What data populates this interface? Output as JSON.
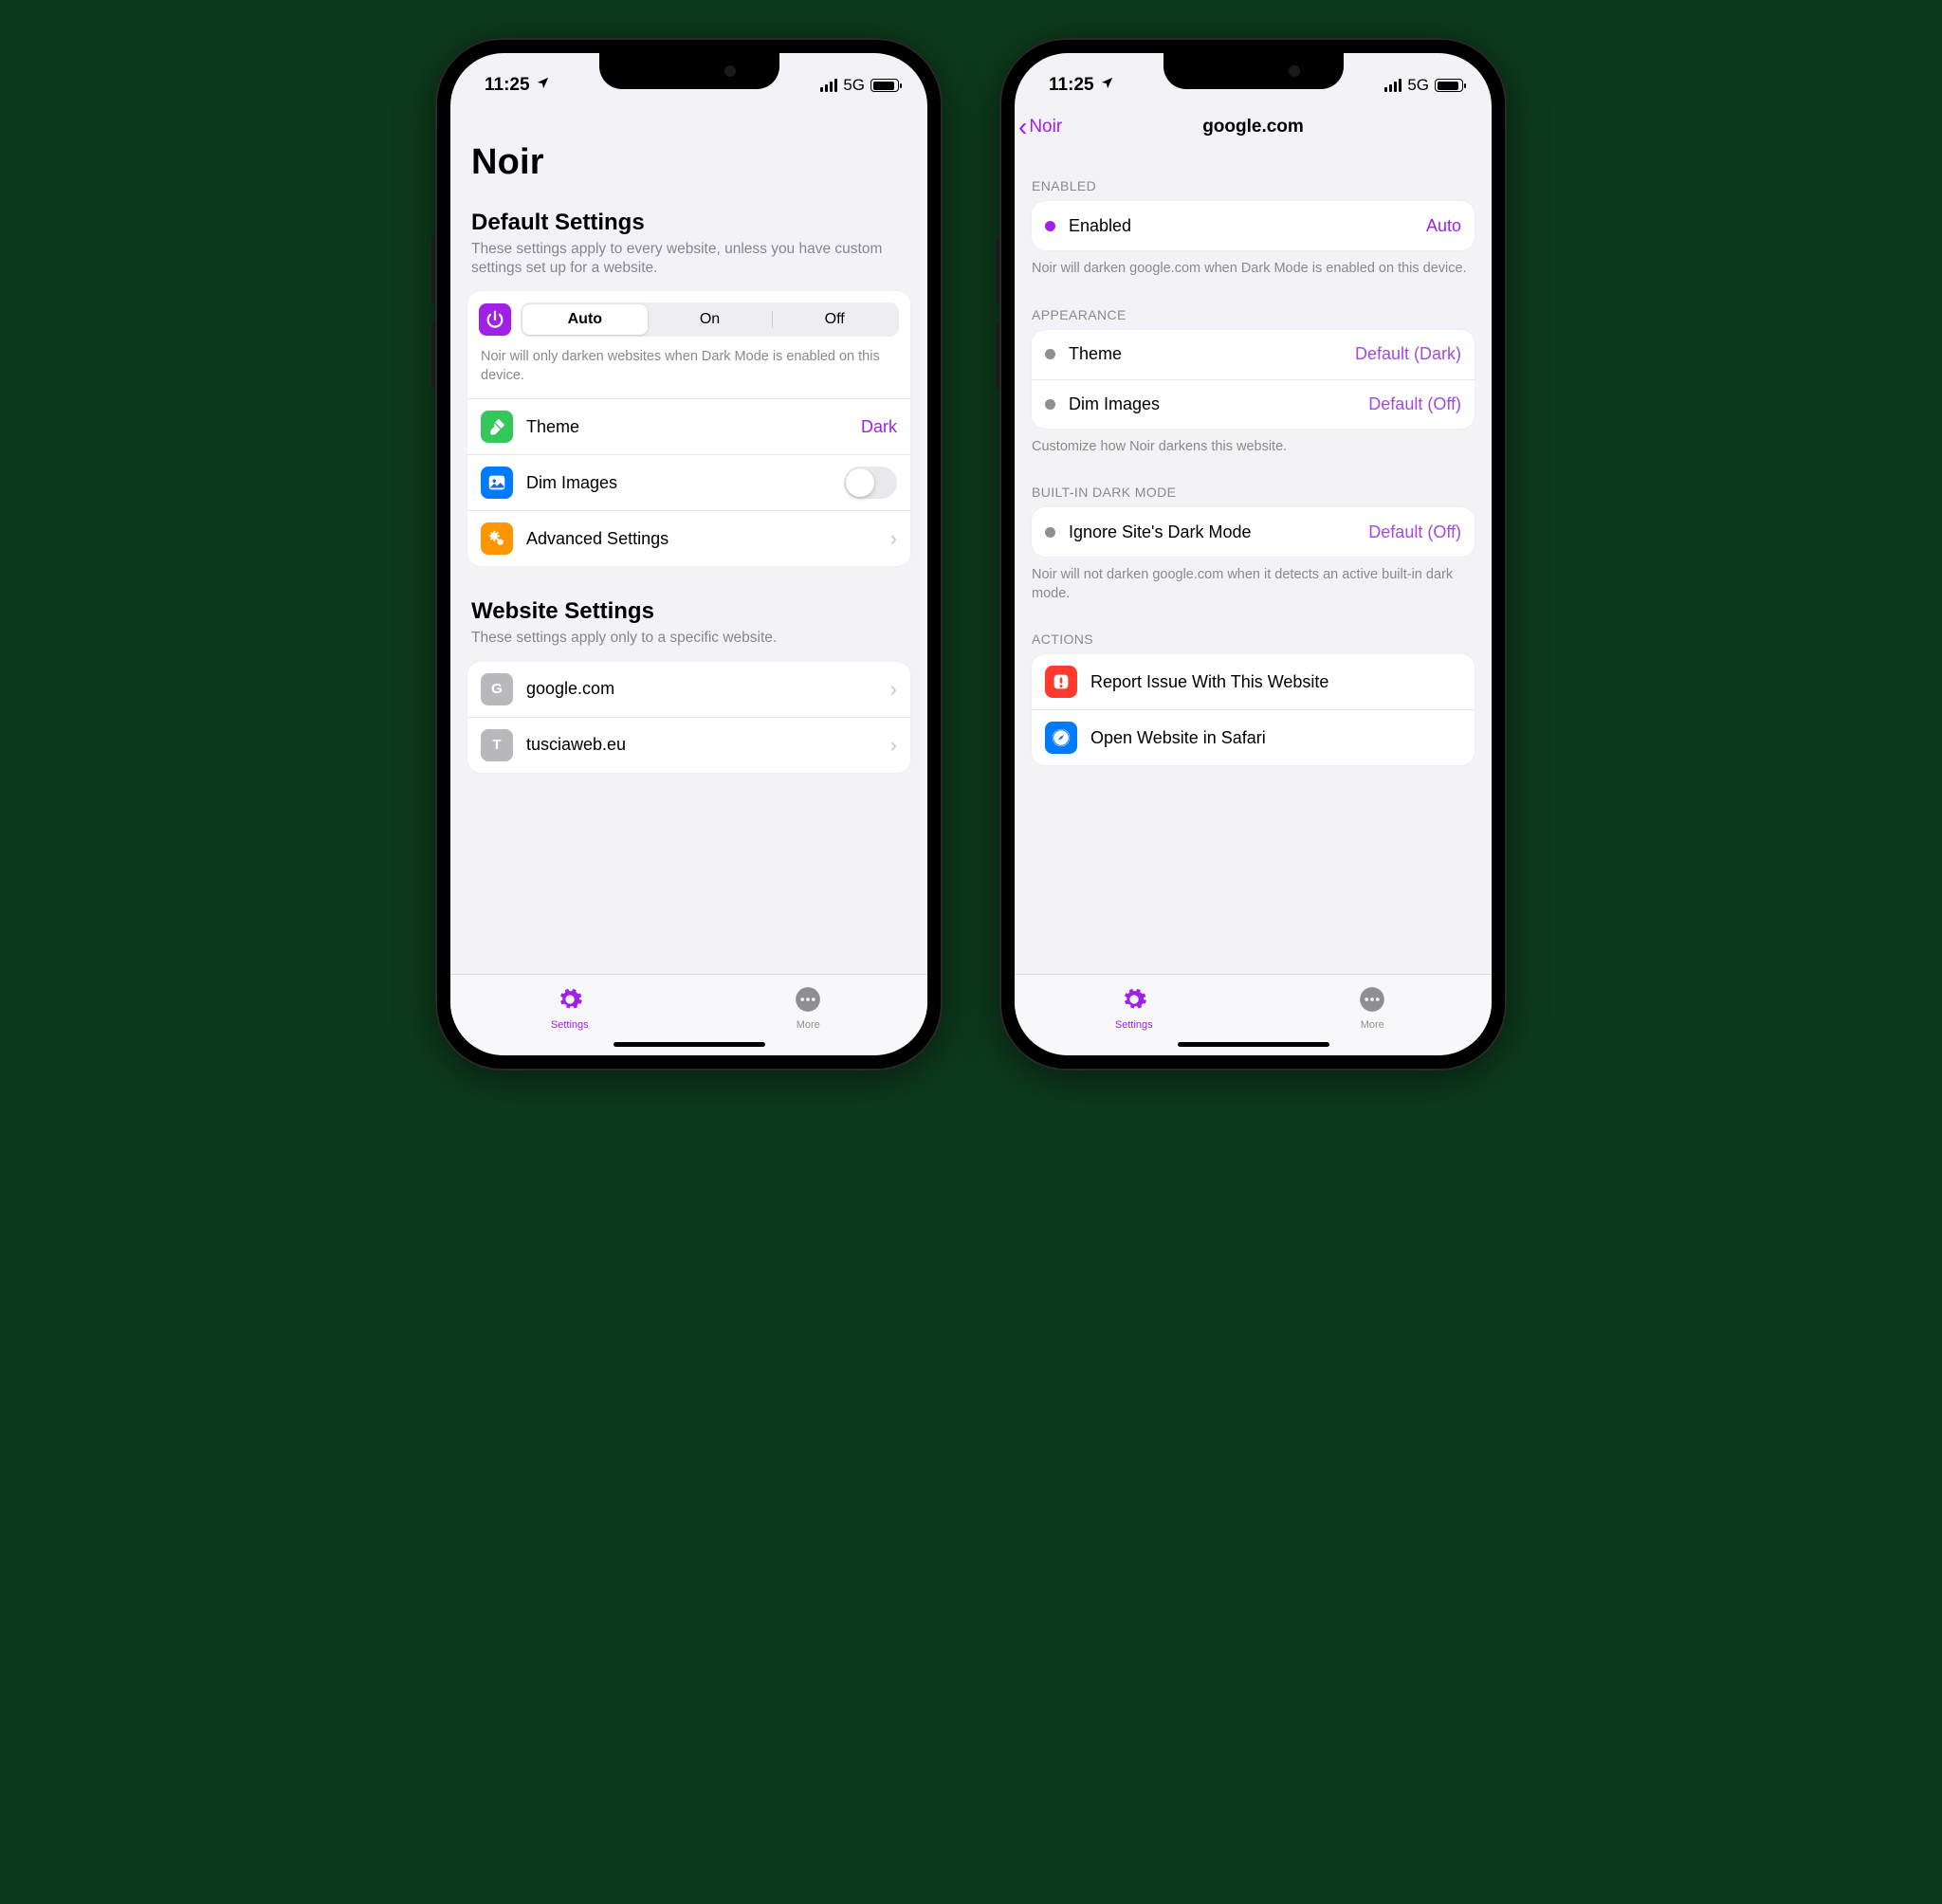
{
  "status": {
    "time": "11:25",
    "network": "5G"
  },
  "tabs": {
    "settings": "Settings",
    "more": "More"
  },
  "left": {
    "title": "Noir",
    "defaults": {
      "header": "Default Settings",
      "subtitle": "These settings apply to every website, unless you have custom settings set up for a website.",
      "segments": {
        "auto": "Auto",
        "on": "On",
        "off": "Off"
      },
      "hint": "Noir will only darken websites when Dark Mode is enabled on this device.",
      "theme_label": "Theme",
      "theme_value": "Dark",
      "dim_label": "Dim Images",
      "advanced_label": "Advanced Settings"
    },
    "website": {
      "header": "Website Settings",
      "subtitle": "These settings apply only to a specific website.",
      "items": [
        {
          "letter": "G",
          "label": "google.com"
        },
        {
          "letter": "T",
          "label": "tusciaweb.eu"
        }
      ]
    }
  },
  "right": {
    "back": "Noir",
    "title": "google.com",
    "enabled": {
      "header": "ENABLED",
      "label": "Enabled",
      "value": "Auto",
      "footer": "Noir will darken google.com when Dark Mode is enabled on this device."
    },
    "appearance": {
      "header": "APPEARANCE",
      "theme_label": "Theme",
      "theme_value": "Default (Dark)",
      "dim_label": "Dim Images",
      "dim_value": "Default (Off)",
      "footer": "Customize how Noir darkens this website."
    },
    "builtin": {
      "header": "BUILT-IN DARK MODE",
      "label": "Ignore Site's Dark Mode",
      "value": "Default (Off)",
      "footer": "Noir will not darken google.com when it detects an active built-in dark mode."
    },
    "actions": {
      "header": "ACTIONS",
      "report": "Report Issue With This Website",
      "open": "Open Website in Safari"
    }
  }
}
